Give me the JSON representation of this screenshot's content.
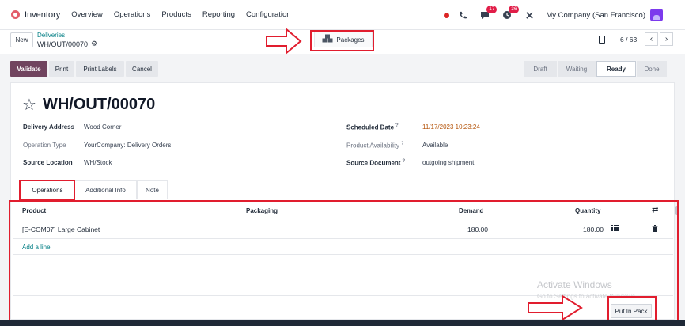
{
  "topnav": {
    "app_name": "Inventory",
    "menu": [
      "Overview",
      "Operations",
      "Products",
      "Reporting",
      "Configuration"
    ],
    "messages_badge": "17",
    "activities_badge": "36",
    "company": "My Company (San Francisco)"
  },
  "control": {
    "new_label": "New",
    "breadcrumb_parent": "Deliveries",
    "breadcrumb_current": "WH/OUT/00070",
    "packages_label": "Packages",
    "pager": "6 / 63"
  },
  "statusbar": {
    "validate": "Validate",
    "print": "Print",
    "print_labels": "Print Labels",
    "cancel": "Cancel",
    "stages": [
      "Draft",
      "Waiting",
      "Ready",
      "Done"
    ],
    "active_stage": "Ready"
  },
  "record": {
    "title": "WH/OUT/00070",
    "fields_left": [
      {
        "label": "Delivery Address",
        "value": "Wood Corner"
      },
      {
        "label": "Operation Type",
        "value": "YourCompany: Delivery Orders"
      },
      {
        "label": "Source Location",
        "value": "WH/Stock"
      }
    ],
    "fields_right": [
      {
        "label": "Scheduled Date",
        "value": "11/17/2023 10:23:24"
      },
      {
        "label": "Product Availability",
        "value": "Available"
      },
      {
        "label": "Source Document",
        "value": "outgoing shipment"
      }
    ]
  },
  "tabs": [
    "Operations",
    "Additional Info",
    "Note"
  ],
  "table": {
    "columns": [
      "Product",
      "Packaging",
      "Demand",
      "Quantity"
    ],
    "rows": [
      {
        "product": "[E-COM07] Large Cabinet",
        "packaging": "",
        "demand": "180.00",
        "quantity": "180.00"
      }
    ],
    "add_line": "Add a line"
  },
  "footer": {
    "put_in_pack": "Put In Pack",
    "watermark_title": "Activate Windows",
    "watermark_sub": "Go to Settings to activate Windows."
  },
  "colors": {
    "primary": "#71445f",
    "link": "#017e84",
    "annotation_red": "#e11d2e",
    "date": "#b45309"
  }
}
